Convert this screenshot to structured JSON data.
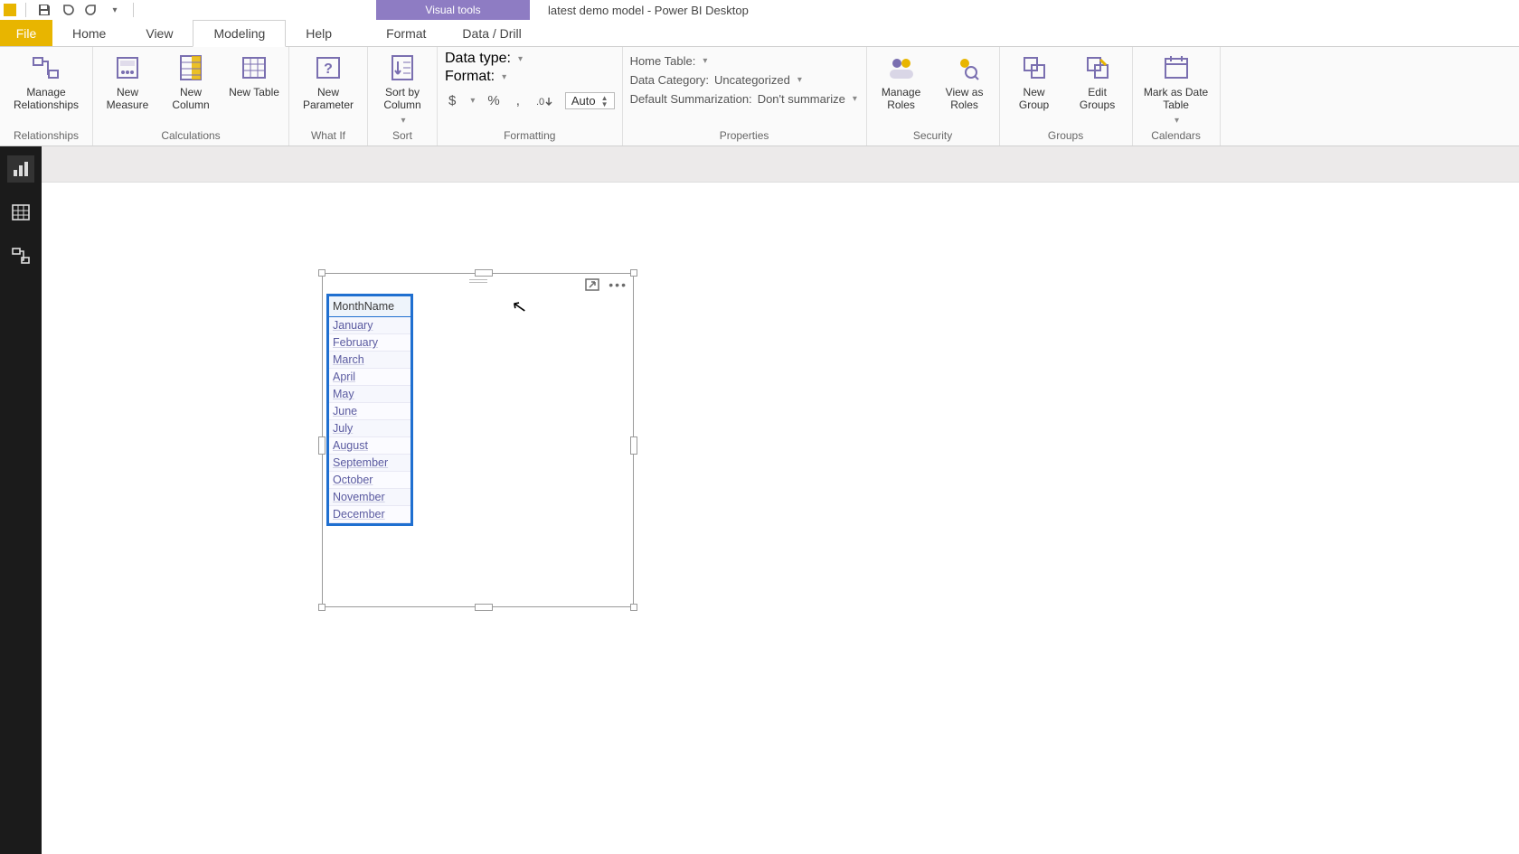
{
  "app": {
    "context_tab_header": "Visual tools",
    "document_title": "latest demo model - Power BI Desktop"
  },
  "tabs": {
    "file": "File",
    "home": "Home",
    "view": "View",
    "modeling": "Modeling",
    "help": "Help",
    "format": "Format",
    "data_drill": "Data / Drill"
  },
  "ribbon": {
    "relationships": {
      "manage_relationships": "Manage Relationships",
      "group_label": "Relationships"
    },
    "calculations": {
      "new_measure": "New Measure",
      "new_column": "New Column",
      "new_table": "New Table",
      "group_label": "Calculations"
    },
    "whatif": {
      "new_parameter": "New Parameter",
      "group_label": "What If"
    },
    "sort": {
      "sort_by_column": "Sort by Column",
      "group_label": "Sort"
    },
    "formatting": {
      "data_type_label": "Data type:",
      "format_label": "Format:",
      "currency": "$",
      "percent": "%",
      "comma": ",",
      "decimals_icon": ".0",
      "auto": "Auto",
      "group_label": "Formatting"
    },
    "properties": {
      "home_table_label": "Home Table:",
      "data_category_label": "Data Category:",
      "data_category_value": "Uncategorized",
      "summarization_label": "Default Summarization:",
      "summarization_value": "Don't summarize",
      "group_label": "Properties"
    },
    "security": {
      "manage_roles": "Manage Roles",
      "view_as_roles": "View as Roles",
      "group_label": "Security"
    },
    "groups": {
      "new_group": "New Group",
      "edit_groups": "Edit Groups",
      "group_label": "Groups"
    },
    "calendars": {
      "mark_as_date_table": "Mark as Date Table",
      "group_label": "Calendars"
    }
  },
  "visual": {
    "column_header": "MonthName",
    "rows": [
      "January",
      "February",
      "March",
      "April",
      "May",
      "June",
      "July",
      "August",
      "September",
      "October",
      "November",
      "December"
    ]
  }
}
